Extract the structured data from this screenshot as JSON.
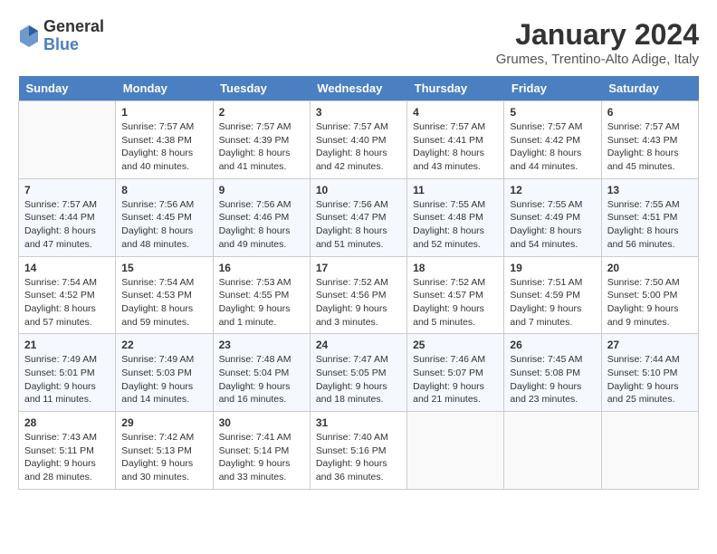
{
  "header": {
    "logo": {
      "general": "General",
      "blue": "Blue"
    },
    "title": "January 2024",
    "location": "Grumes, Trentino-Alto Adige, Italy"
  },
  "days_of_week": [
    "Sunday",
    "Monday",
    "Tuesday",
    "Wednesday",
    "Thursday",
    "Friday",
    "Saturday"
  ],
  "weeks": [
    [
      {
        "day": "",
        "info": ""
      },
      {
        "day": "1",
        "info": "Sunrise: 7:57 AM\nSunset: 4:38 PM\nDaylight: 8 hours and 40 minutes."
      },
      {
        "day": "2",
        "info": "Sunrise: 7:57 AM\nSunset: 4:39 PM\nDaylight: 8 hours and 41 minutes."
      },
      {
        "day": "3",
        "info": "Sunrise: 7:57 AM\nSunset: 4:40 PM\nDaylight: 8 hours and 42 minutes."
      },
      {
        "day": "4",
        "info": "Sunrise: 7:57 AM\nSunset: 4:41 PM\nDaylight: 8 hours and 43 minutes."
      },
      {
        "day": "5",
        "info": "Sunrise: 7:57 AM\nSunset: 4:42 PM\nDaylight: 8 hours and 44 minutes."
      },
      {
        "day": "6",
        "info": "Sunrise: 7:57 AM\nSunset: 4:43 PM\nDaylight: 8 hours and 45 minutes."
      }
    ],
    [
      {
        "day": "7",
        "info": "Sunrise: 7:57 AM\nSunset: 4:44 PM\nDaylight: 8 hours and 47 minutes."
      },
      {
        "day": "8",
        "info": "Sunrise: 7:56 AM\nSunset: 4:45 PM\nDaylight: 8 hours and 48 minutes."
      },
      {
        "day": "9",
        "info": "Sunrise: 7:56 AM\nSunset: 4:46 PM\nDaylight: 8 hours and 49 minutes."
      },
      {
        "day": "10",
        "info": "Sunrise: 7:56 AM\nSunset: 4:47 PM\nDaylight: 8 hours and 51 minutes."
      },
      {
        "day": "11",
        "info": "Sunrise: 7:55 AM\nSunset: 4:48 PM\nDaylight: 8 hours and 52 minutes."
      },
      {
        "day": "12",
        "info": "Sunrise: 7:55 AM\nSunset: 4:49 PM\nDaylight: 8 hours and 54 minutes."
      },
      {
        "day": "13",
        "info": "Sunrise: 7:55 AM\nSunset: 4:51 PM\nDaylight: 8 hours and 56 minutes."
      }
    ],
    [
      {
        "day": "14",
        "info": "Sunrise: 7:54 AM\nSunset: 4:52 PM\nDaylight: 8 hours and 57 minutes."
      },
      {
        "day": "15",
        "info": "Sunrise: 7:54 AM\nSunset: 4:53 PM\nDaylight: 8 hours and 59 minutes."
      },
      {
        "day": "16",
        "info": "Sunrise: 7:53 AM\nSunset: 4:55 PM\nDaylight: 9 hours and 1 minute."
      },
      {
        "day": "17",
        "info": "Sunrise: 7:52 AM\nSunset: 4:56 PM\nDaylight: 9 hours and 3 minutes."
      },
      {
        "day": "18",
        "info": "Sunrise: 7:52 AM\nSunset: 4:57 PM\nDaylight: 9 hours and 5 minutes."
      },
      {
        "day": "19",
        "info": "Sunrise: 7:51 AM\nSunset: 4:59 PM\nDaylight: 9 hours and 7 minutes."
      },
      {
        "day": "20",
        "info": "Sunrise: 7:50 AM\nSunset: 5:00 PM\nDaylight: 9 hours and 9 minutes."
      }
    ],
    [
      {
        "day": "21",
        "info": "Sunrise: 7:49 AM\nSunset: 5:01 PM\nDaylight: 9 hours and 11 minutes."
      },
      {
        "day": "22",
        "info": "Sunrise: 7:49 AM\nSunset: 5:03 PM\nDaylight: 9 hours and 14 minutes."
      },
      {
        "day": "23",
        "info": "Sunrise: 7:48 AM\nSunset: 5:04 PM\nDaylight: 9 hours and 16 minutes."
      },
      {
        "day": "24",
        "info": "Sunrise: 7:47 AM\nSunset: 5:05 PM\nDaylight: 9 hours and 18 minutes."
      },
      {
        "day": "25",
        "info": "Sunrise: 7:46 AM\nSunset: 5:07 PM\nDaylight: 9 hours and 21 minutes."
      },
      {
        "day": "26",
        "info": "Sunrise: 7:45 AM\nSunset: 5:08 PM\nDaylight: 9 hours and 23 minutes."
      },
      {
        "day": "27",
        "info": "Sunrise: 7:44 AM\nSunset: 5:10 PM\nDaylight: 9 hours and 25 minutes."
      }
    ],
    [
      {
        "day": "28",
        "info": "Sunrise: 7:43 AM\nSunset: 5:11 PM\nDaylight: 9 hours and 28 minutes."
      },
      {
        "day": "29",
        "info": "Sunrise: 7:42 AM\nSunset: 5:13 PM\nDaylight: 9 hours and 30 minutes."
      },
      {
        "day": "30",
        "info": "Sunrise: 7:41 AM\nSunset: 5:14 PM\nDaylight: 9 hours and 33 minutes."
      },
      {
        "day": "31",
        "info": "Sunrise: 7:40 AM\nSunset: 5:16 PM\nDaylight: 9 hours and 36 minutes."
      },
      {
        "day": "",
        "info": ""
      },
      {
        "day": "",
        "info": ""
      },
      {
        "day": "",
        "info": ""
      }
    ]
  ]
}
